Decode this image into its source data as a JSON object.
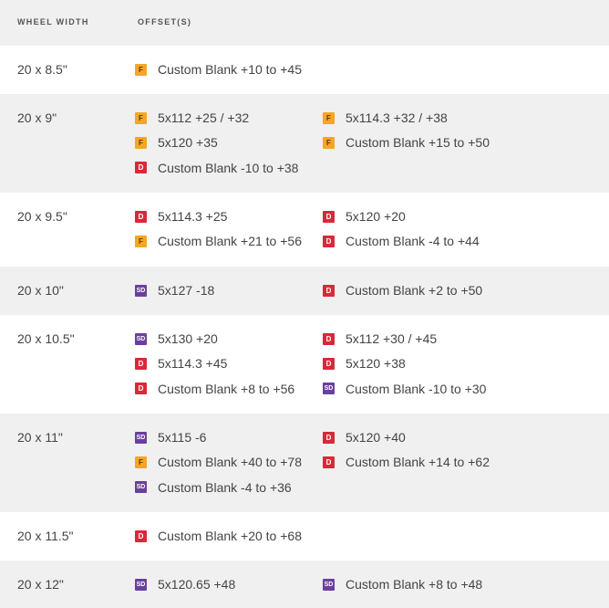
{
  "header": {
    "wheel_width": "WHEEL WIDTH",
    "offsets": "OFFSET(S)"
  },
  "colors": {
    "F": "#f5a623",
    "D": "#d9283a",
    "SD": "#6b3fa0",
    "row_shade": "#f0f0f0"
  },
  "rows": [
    {
      "width": "20 x 8.5\"",
      "col1": [
        {
          "badge": "F",
          "text": "Custom Blank +10 to +45"
        }
      ],
      "col2": []
    },
    {
      "width": "20 x 9\"",
      "col1": [
        {
          "badge": "F",
          "text": "5x112 +25 / +32"
        },
        {
          "badge": "F",
          "text": "5x120 +35"
        },
        {
          "badge": "D",
          "text": "Custom Blank -10 to +38"
        }
      ],
      "col2": [
        {
          "badge": "F",
          "text": "5x114.3 +32 / +38"
        },
        {
          "badge": "F",
          "text": "Custom Blank +15 to +50"
        }
      ]
    },
    {
      "width": "20 x 9.5\"",
      "col1": [
        {
          "badge": "D",
          "text": "5x114.3 +25"
        },
        {
          "badge": "F",
          "text": "Custom Blank +21 to +56"
        }
      ],
      "col2": [
        {
          "badge": "D",
          "text": "5x120 +20"
        },
        {
          "badge": "D",
          "text": "Custom Blank -4 to +44"
        }
      ]
    },
    {
      "width": "20 x 10\"",
      "col1": [
        {
          "badge": "SD",
          "text": "5x127 -18"
        }
      ],
      "col2": [
        {
          "badge": "D",
          "text": "Custom Blank +2 to +50"
        }
      ]
    },
    {
      "width": "20 x 10.5\"",
      "col1": [
        {
          "badge": "SD",
          "text": "5x130 +20"
        },
        {
          "badge": "D",
          "text": "5x114.3 +45"
        },
        {
          "badge": "D",
          "text": "Custom Blank +8 to +56"
        }
      ],
      "col2": [
        {
          "badge": "D",
          "text": "5x112 +30 / +45"
        },
        {
          "badge": "D",
          "text": "5x120 +38"
        },
        {
          "badge": "SD",
          "text": "Custom Blank -10 to +30"
        }
      ]
    },
    {
      "width": "20 x 11\"",
      "col1": [
        {
          "badge": "SD",
          "text": "5x115 -6"
        },
        {
          "badge": "F",
          "text": "Custom Blank +40 to +78"
        },
        {
          "badge": "SD",
          "text": "Custom Blank -4 to +36"
        }
      ],
      "col2": [
        {
          "badge": "D",
          "text": "5x120 +40"
        },
        {
          "badge": "D",
          "text": "Custom Blank +14 to +62"
        }
      ]
    },
    {
      "width": "20 x 11.5\"",
      "col1": [
        {
          "badge": "D",
          "text": "Custom Blank +20 to +68"
        }
      ],
      "col2": []
    },
    {
      "width": "20 x 12\"",
      "col1": [
        {
          "badge": "SD",
          "text": "5x120.65 +48"
        }
      ],
      "col2": [
        {
          "badge": "SD",
          "text": "Custom Blank +8 to +48"
        }
      ]
    }
  ]
}
